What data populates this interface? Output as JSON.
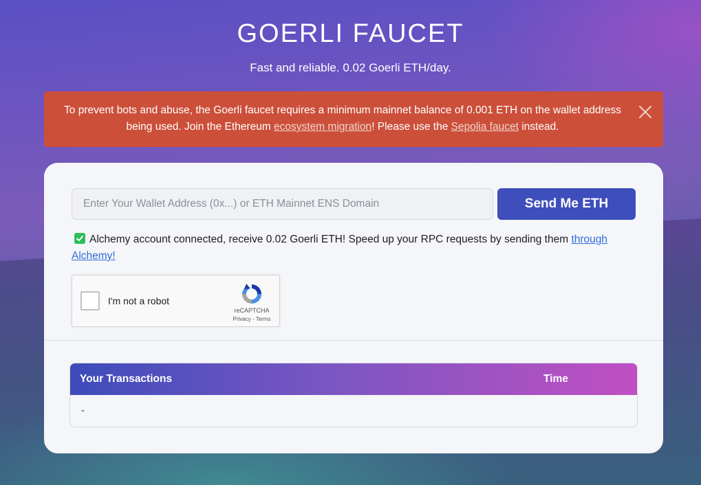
{
  "header": {
    "title": "GOERLI FAUCET",
    "subtitle": "Fast and reliable. 0.02 Goerli ETH/day."
  },
  "alert": {
    "text_before": "To prevent bots and abuse, the Goerli faucet requires a minimum mainnet balance of 0.001 ETH on the wallet address being used. Join the Ethereum ",
    "link1": "ecosystem migration",
    "text_middle": "! Please use the ",
    "link2": "Sepolia faucet",
    "text_after": " instead.",
    "background": "#cc4f3a"
  },
  "form": {
    "address_placeholder": "Enter Your Wallet Address (0x...) or ETH Mainnet ENS Domain",
    "address_value": "",
    "send_button": "Send Me ETH",
    "button_color": "#3e4ebc"
  },
  "alchemy": {
    "checked": true,
    "text": "Alchemy account connected, receive 0.02 Goerli ETH! Speed up your RPC requests by sending them ",
    "link": "through Alchemy!"
  },
  "captcha": {
    "label": "I'm not a robot",
    "brand": "reCAPTCHA",
    "privacy": "Privacy",
    "separator": " - ",
    "terms": "Terms"
  },
  "transactions": {
    "headers": [
      "Your Transactions",
      "Time"
    ],
    "rows": [
      [
        "-",
        ""
      ]
    ]
  },
  "icons": {
    "close": "close-icon",
    "check": "checkmark-icon",
    "recaptcha": "recaptcha-logo-icon"
  }
}
